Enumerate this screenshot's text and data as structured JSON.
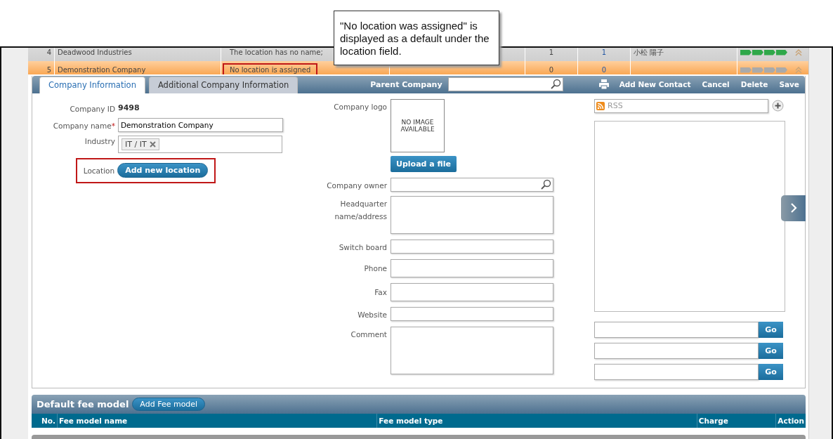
{
  "callout": {
    "text": "\"No location was assigned\" is displayed as a default under the location field."
  },
  "rows": [
    {
      "no": "4",
      "name": "Deadwood Industries",
      "location": "The location has no name;",
      "highlighted": false,
      "selected": false,
      "count_1": "1",
      "count_2": "1",
      "owner": "小松  陽子",
      "stars": 4
    },
    {
      "no": "5",
      "name": "Demonstration Company",
      "location": "No location is assigned",
      "highlighted": true,
      "selected": true,
      "count_1": "0",
      "count_2": "0",
      "owner": "",
      "stars": 0
    }
  ],
  "tabs": [
    {
      "label": "Company Information",
      "selected": true
    },
    {
      "label": "Additional Company Information",
      "selected": false
    }
  ],
  "parent_company": {
    "label": "Parent Company"
  },
  "actions": [
    "Add New Contact",
    "Cancel",
    "Delete",
    "Save"
  ],
  "company_id": {
    "label": "Company ID",
    "value": "9498"
  },
  "company_name": {
    "label": "Company name",
    "required_mark": "*",
    "value": "Demonstration Company"
  },
  "industry": {
    "label": "Industry",
    "tags": [
      "IT / IT"
    ]
  },
  "location": {
    "label": "Location",
    "button": "Add new location",
    "highlighted": true
  },
  "logo": {
    "label": "Company logo",
    "placeholder_text": "NO IMAGE AVAILABLE",
    "button": "Upload a file"
  },
  "company_owner": {
    "label": "Company owner"
  },
  "fields": [
    {
      "label": "Headquarter name/address",
      "kind": "textarea"
    },
    {
      "label": "Switch board",
      "kind": "short"
    },
    {
      "label": "Phone",
      "kind": "tall"
    },
    {
      "label": "Fax",
      "kind": "tall"
    },
    {
      "label": "Website",
      "kind": "short"
    },
    {
      "label": "Comment",
      "kind": "textarea"
    }
  ],
  "rss": {
    "placeholder": "RSS"
  },
  "go_buttons": [
    "Go",
    "Go",
    "Go"
  ],
  "fee_model": {
    "title": "Default fee model",
    "button": "Add Fee model",
    "columns": [
      "No.",
      "Fee model name",
      "Fee model type",
      "Charge",
      "Action"
    ]
  }
}
